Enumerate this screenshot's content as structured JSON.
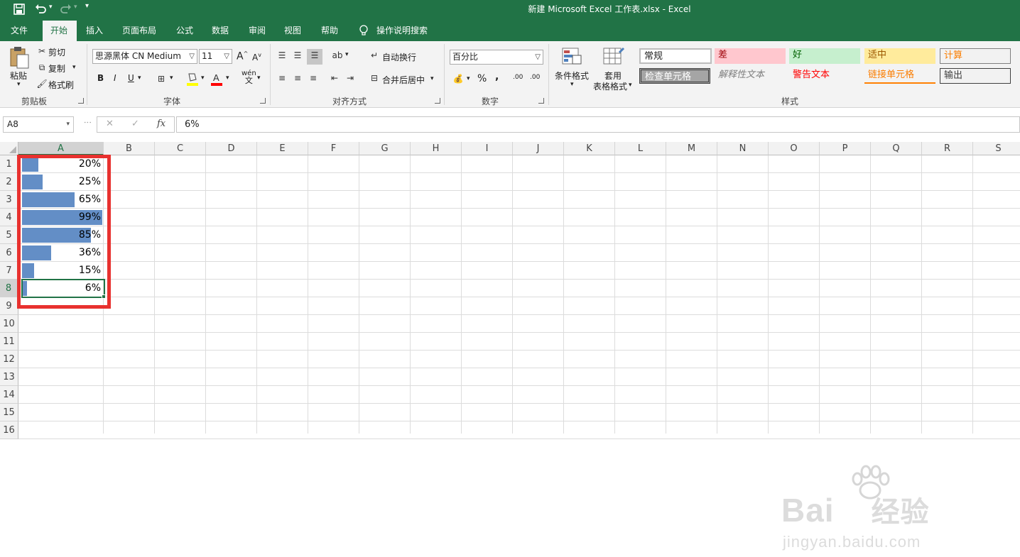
{
  "window": {
    "title": "新建 Microsoft Excel 工作表.xlsx  -  Excel"
  },
  "quick_access": {
    "save_icon": "save-icon",
    "undo_icon": "undo-icon",
    "redo_icon": "redo-icon",
    "customize_icon": "customize-icon"
  },
  "menu": {
    "tabs": [
      "文件",
      "开始",
      "插入",
      "页面布局",
      "公式",
      "数据",
      "审阅",
      "视图",
      "帮助"
    ],
    "active": "开始",
    "search_label": "操作说明搜索"
  },
  "ribbon": {
    "clipboard": {
      "paste": "粘贴",
      "cut": "剪切",
      "copy": "复制",
      "format_painter": "格式刷",
      "label": "剪贴板"
    },
    "font": {
      "name": "思源黑体 CN Medium",
      "size": "11",
      "grow": "A",
      "shrink": "A",
      "bold": "B",
      "italic": "I",
      "underline": "U",
      "wen": "wén",
      "label": "字体"
    },
    "alignment": {
      "wrap": "自动换行",
      "merge": "合并后居中",
      "label": "对齐方式"
    },
    "number": {
      "format": "百分比",
      "percent": "%",
      "comma": ",",
      "inc": ".00",
      "dec": ".00",
      "label": "数字"
    },
    "styles": {
      "cond_format": "条件格式",
      "table_format_1": "套用",
      "table_format_2": "表格格式",
      "cells": [
        {
          "text": "常规",
          "bg": "#ffffff",
          "color": "#000000"
        },
        {
          "text": "差",
          "bg": "#ffc7ce",
          "color": "#9c0006"
        },
        {
          "text": "好",
          "bg": "#c6efce",
          "color": "#006100"
        },
        {
          "text": "适中",
          "bg": "#ffeb9c",
          "color": "#9c5700"
        },
        {
          "text": "计算",
          "bg": "#f2f2f2",
          "color": "#fa7d00"
        },
        {
          "text": "检查单元格",
          "bg": "#a5a5a5",
          "color": "#ffffff"
        },
        {
          "text": "解释性文本",
          "bg": "#ffffff",
          "color": "#7f7f7f"
        },
        {
          "text": "警告文本",
          "bg": "#ffffff",
          "color": "#ff0000"
        },
        {
          "text": "链接单元格",
          "bg": "#ffffff",
          "color": "#fa7d00"
        },
        {
          "text": "输出",
          "bg": "#f2f2f2",
          "color": "#3f3f3f"
        }
      ],
      "label": "样式"
    }
  },
  "formula_bar": {
    "name_box": "A8",
    "cancel": "✕",
    "enter": "✓",
    "fx": "fx",
    "value": "6%"
  },
  "grid": {
    "columns": [
      "A",
      "B",
      "C",
      "D",
      "E",
      "F",
      "G",
      "H",
      "I",
      "J",
      "K",
      "L",
      "M",
      "N",
      "O",
      "P",
      "Q",
      "R",
      "S"
    ],
    "rows": [
      "1",
      "2",
      "3",
      "4",
      "5",
      "6",
      "7",
      "8",
      "9",
      "10",
      "11",
      "12",
      "13",
      "14",
      "15",
      "16"
    ],
    "col_a_values": [
      "20%",
      "25%",
      "65%",
      "99%",
      "85%",
      "36%",
      "15%",
      "6%"
    ],
    "col_a_fractions": [
      0.2,
      0.25,
      0.65,
      0.99,
      0.85,
      0.36,
      0.15,
      0.06
    ],
    "databar_color": "#638ec6",
    "selected_cell": "A8"
  },
  "watermark": {
    "brand": "Bai",
    "brand_cn": "经验",
    "url": "jingyan.baidu.com"
  }
}
